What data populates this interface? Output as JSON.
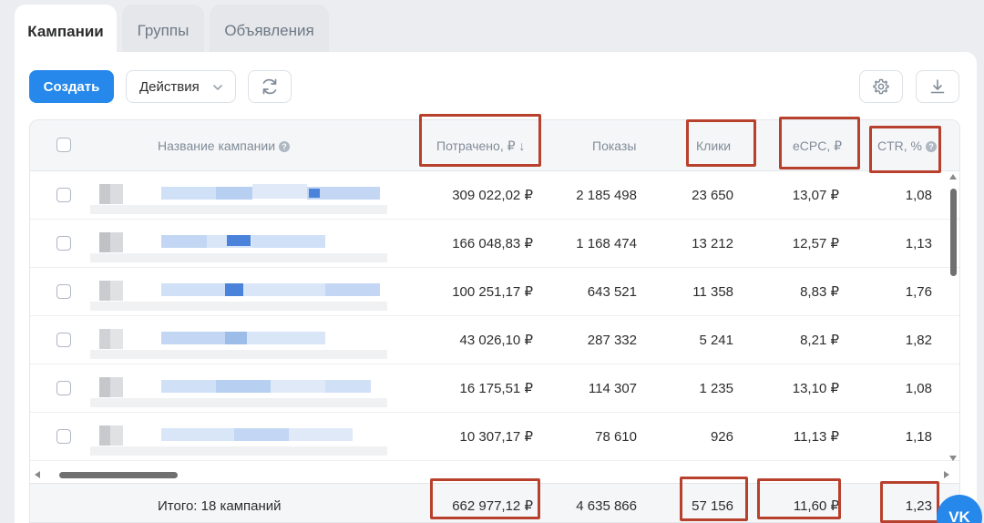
{
  "tabs": [
    {
      "label": "Кампании",
      "active": true
    },
    {
      "label": "Группы",
      "active": false
    },
    {
      "label": "Объявления",
      "active": false
    }
  ],
  "toolbar": {
    "create_label": "Создать",
    "actions_label": "Действия"
  },
  "icons": {
    "refresh": "refresh-icon",
    "settings": "gear-icon",
    "download": "download-icon",
    "chevron": "chevron-down-icon"
  },
  "table": {
    "columns": {
      "name": "Название кампании",
      "spent": "Потрачено, ₽ ↓",
      "impressions": "Показы",
      "clicks": "Клики",
      "ecpc": "eCPC, ₽",
      "ctr": "CTR, %"
    },
    "rows": [
      {
        "spent": "309 022,02 ₽",
        "impressions": "2 185 498",
        "clicks": "23 650",
        "ecpc": "13,07 ₽",
        "ctr": "1,08"
      },
      {
        "spent": "166 048,83 ₽",
        "impressions": "1 168 474",
        "clicks": "13 212",
        "ecpc": "12,57 ₽",
        "ctr": "1,13"
      },
      {
        "spent": "100 251,17 ₽",
        "impressions": "643 521",
        "clicks": "11 358",
        "ecpc": "8,83 ₽",
        "ctr": "1,76"
      },
      {
        "spent": "43 026,10 ₽",
        "impressions": "287 332",
        "clicks": "5 241",
        "ecpc": "8,21 ₽",
        "ctr": "1,82"
      },
      {
        "spent": "16 175,51 ₽",
        "impressions": "114 307",
        "clicks": "1 235",
        "ecpc": "13,10 ₽",
        "ctr": "1,08"
      },
      {
        "spent": "10 307,17 ₽",
        "impressions": "78 610",
        "clicks": "926",
        "ecpc": "11,13 ₽",
        "ctr": "1,18"
      }
    ],
    "total": {
      "label": "Итого: 18 кампаний",
      "spent": "662 977,12 ₽",
      "impressions": "4 635 866",
      "clicks": "57 156",
      "ecpc": "11,60 ₽",
      "ctr": "1,23"
    }
  },
  "colors": {
    "accent": "#2688eb",
    "highlight_box": "#b8412e"
  },
  "vk_badge": "VK"
}
